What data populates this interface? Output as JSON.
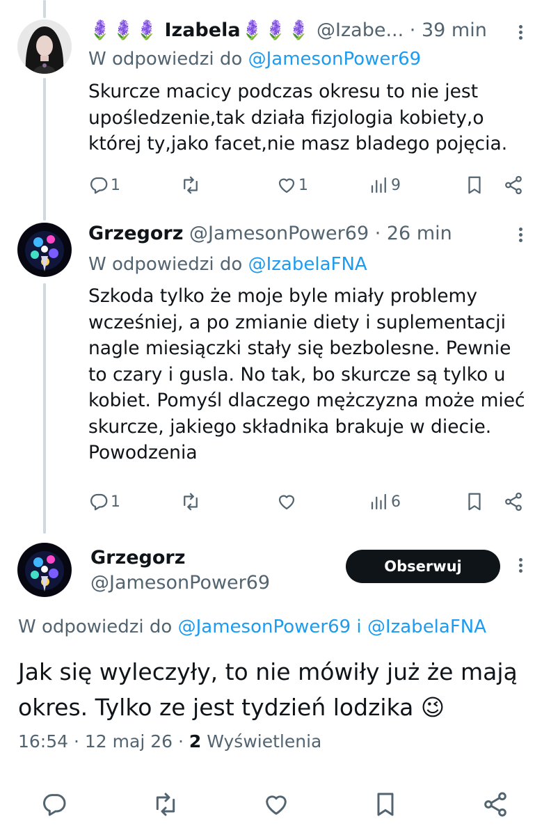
{
  "tweets": [
    {
      "name": "Izabela",
      "name_emoji_left": "🪻🪻🪻",
      "name_emoji_right": "🪻🪻🪻",
      "handle": "@Izabe...",
      "time": "· 39 min",
      "reply_prefix": "W odpowiedzi do ",
      "reply_to": "@JamesonPower69",
      "text": "Skurcze macicy podczas okresu to nie jest\nupośledzenie,tak działa fizjologia kobiety,o\nktórej ty,jako facet,nie masz bladego pojęcia.",
      "replies": "1",
      "retweets": "",
      "likes": "1",
      "views": "9"
    },
    {
      "name": "Grzegorz",
      "handle": "@JamesonPower69",
      "time": "· 26 min",
      "reply_prefix": "W odpowiedzi do ",
      "reply_to": "@IzabelaFNA",
      "text": "Szkoda tylko że moje byle miały problemy\nwcześniej, a po zmianie diety i suplementacji\nnagle miesiączki stały się bezbolesne. Pewnie\nto czary i gusla. No tak, bo skurcze są tylko u\nkobiet. Pomyśl dlaczego mężczyzna może mieć\nskurcze, jakiego składnika brakuje w diecie.\nPowodzenia",
      "replies": "1",
      "retweets": "",
      "likes": "",
      "views": "6"
    }
  ],
  "main_tweet": {
    "name": "Grzegorz",
    "handle": "@JamesonPower69",
    "follow_label": "Obserwuj",
    "reply_prefix": "W odpowiedzi do ",
    "reply_to_1": "@JamesonPower69",
    "reply_and": " i ",
    "reply_to_2": "@IzabelaFNA",
    "text": "Jak się wyleczyły, to nie mówiły już że mają okres. Tylko ze jest tydzień lodzika 😉",
    "time": "16:54",
    "sep1": " · ",
    "date": "12 maj 26",
    "sep2": " · ",
    "views_count": "2",
    "views_label": " Wyświetlenia"
  },
  "icons": [
    "reply-icon",
    "retweet-icon",
    "like-icon",
    "views-icon",
    "bookmark-icon",
    "share-icon",
    "more-icon"
  ],
  "colors": {
    "link": "#1d9bf0",
    "muted": "#536471",
    "text": "#0f1419",
    "thread_line": "#cfd9de",
    "button": "#0f1419"
  }
}
